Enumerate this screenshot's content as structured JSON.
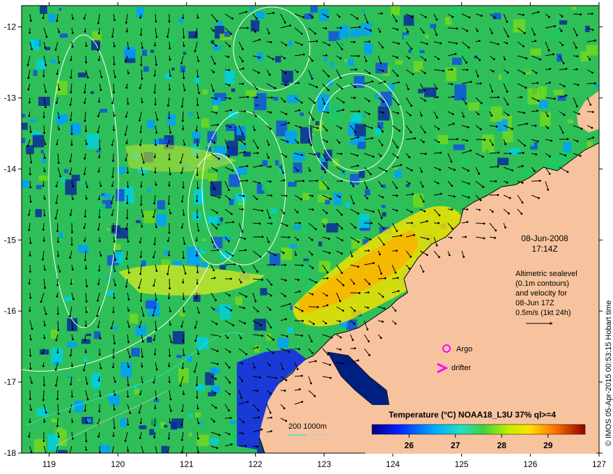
{
  "map": {
    "lon_ticks": [
      "119",
      "120",
      "121",
      "122",
      "123",
      "124",
      "125",
      "126",
      "127"
    ],
    "lat_ticks": [
      "-12",
      "-13",
      "-14",
      "-15",
      "-16",
      "-17",
      "-18"
    ],
    "lon_range": [
      118.6,
      127
    ],
    "lat_range": [
      -18,
      -11.7
    ]
  },
  "annotations": {
    "date": "08-Jun-2008",
    "time": "17:14Z",
    "sealevel_lines": [
      "Altimetric sealevel",
      "(0.1m contours)",
      "and velocity for",
      "08-Jun 17Z",
      "0.5m/s (1kt 24h)"
    ],
    "argo_label": "Argo",
    "drifter_label": "drifter",
    "depth_label": "200  1000m",
    "side_credit": "© IMOS 05-Apr-2015 00:53:15 Hobart time"
  },
  "colorbar": {
    "title": "Temperature (°C) NOAA18_L3U 37% ql>=4",
    "ticks": [
      "26",
      "27",
      "28",
      "29"
    ],
    "range": [
      25.2,
      29.8
    ]
  },
  "colors": {
    "land": "#f7c39e",
    "coast": "#000000",
    "contour": "#ffffff",
    "argo_marker": "#ff00ff",
    "drifter_marker": "#ff00ff",
    "depth_200": "#40e0d0",
    "depth_1000": "#c8c8c8"
  }
}
